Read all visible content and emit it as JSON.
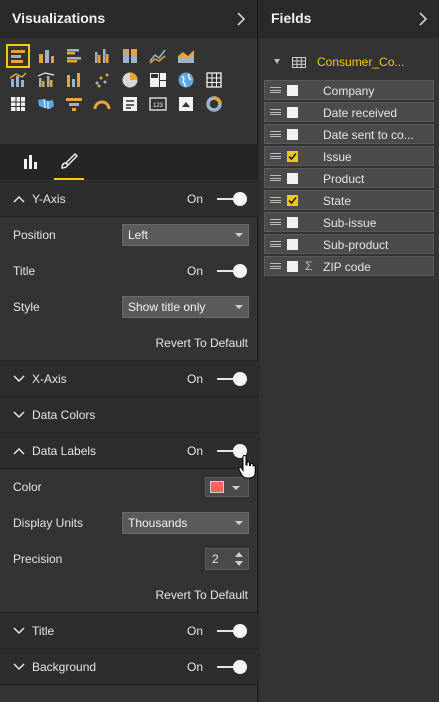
{
  "visualizations": {
    "title": "Visualizations",
    "collapse_icon": "chevron-right-icon",
    "visual_icons": [
      "stacked-bar-chart-icon",
      "stacked-column-chart-icon",
      "clustered-bar-chart-icon",
      "clustered-column-chart-icon",
      "100-stacked-bar-chart-icon",
      "line-chart-icon",
      "area-chart-icon",
      "line-and-stacked-column-chart-icon",
      "line-and-clustered-column-chart-icon",
      "ribbon-chart-icon",
      "scatter-chart-icon",
      "pie-chart-icon",
      "treemap-icon",
      "globe-map-icon",
      "table-icon",
      "filled-map-icon",
      "funnel-icon",
      "gauge-icon",
      "multi-row-card-icon",
      "card-icon",
      "kpi-icon",
      "donut-chart-icon"
    ],
    "tabs": [
      "fields-tab-icon",
      "format-paintbrush-icon"
    ],
    "sections": {
      "y_axis": {
        "title": "Y-Axis",
        "state": "On",
        "expanded": true
      },
      "position": {
        "label": "Position",
        "value": "Left"
      },
      "title_row": {
        "label": "Title",
        "state": "On"
      },
      "style": {
        "label": "Style",
        "value": "Show title only"
      },
      "revert1": "Revert To Default",
      "x_axis": {
        "title": "X-Axis",
        "state": "On",
        "expanded": false
      },
      "data_colors": {
        "title": "Data Colors",
        "expanded": false
      },
      "data_labels": {
        "title": "Data Labels",
        "state": "On",
        "expanded": true
      },
      "color": {
        "label": "Color",
        "value": "#FD625E"
      },
      "display_units": {
        "label": "Display Units",
        "value": "Thousands"
      },
      "precision": {
        "label": "Precision",
        "value": "2"
      },
      "revert2": "Revert To Default",
      "title_section": {
        "title": "Title",
        "state": "On",
        "expanded": false
      },
      "background": {
        "title": "Background",
        "state": "On",
        "expanded": false
      }
    }
  },
  "fields": {
    "title": "Fields",
    "collapse_icon": "chevron-right-icon",
    "table": {
      "name": "Consumer_Co...",
      "icon": "table-icon"
    },
    "items": [
      {
        "name": "Company",
        "checked": false
      },
      {
        "name": "Date received",
        "checked": false
      },
      {
        "name": "Date sent to co...",
        "checked": false
      },
      {
        "name": "Issue",
        "checked": true
      },
      {
        "name": "Product",
        "checked": false
      },
      {
        "name": "State",
        "checked": true
      },
      {
        "name": "Sub-issue",
        "checked": false
      },
      {
        "name": "Sub-product",
        "checked": false
      },
      {
        "name": "ZIP code",
        "checked": false,
        "sigma": "Σ"
      }
    ]
  },
  "colors": {
    "accent": "#F2C811",
    "panel": "#333333",
    "header": "#2A2A2A"
  }
}
